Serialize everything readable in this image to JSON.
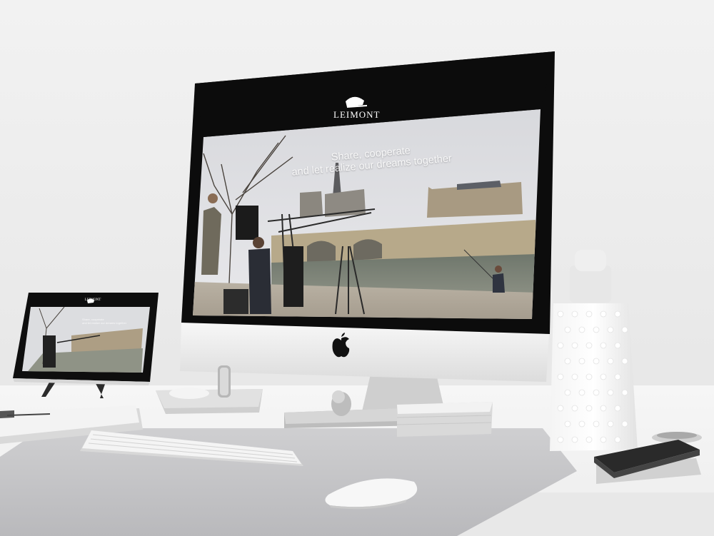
{
  "scene": {
    "description_text": "",
    "imac": {
      "brand_logo_text": "LEIMONT",
      "brand_logo_subtext": "",
      "hero_line1": "Share, cooperate",
      "hero_line2": "and let realize our dreams together",
      "apple_logo_icon": "apple-icon"
    },
    "ipad": {
      "brand_logo_text": "LEIMONT",
      "hero_line1": "Share, cooperate",
      "hero_line2": "and let realize our dreams together"
    }
  }
}
